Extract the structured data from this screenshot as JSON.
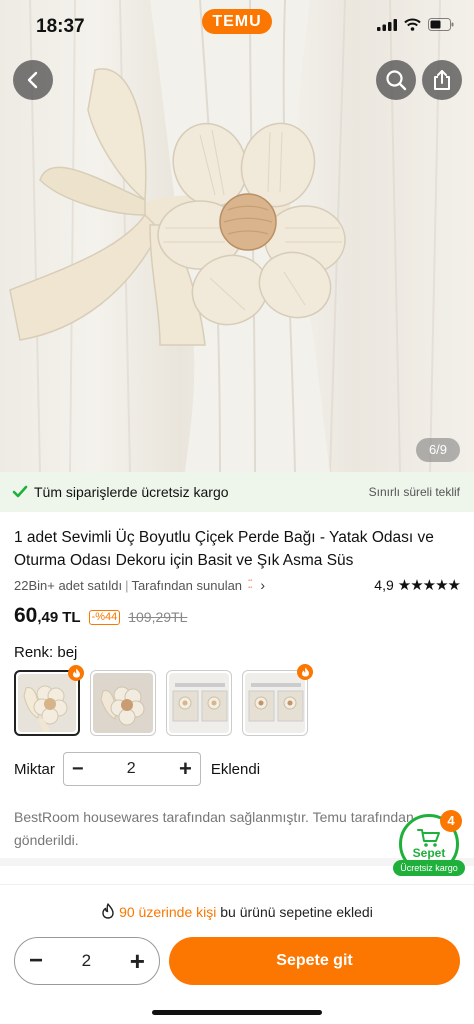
{
  "status_bar": {
    "time": "18:37"
  },
  "app": {
    "logo": "TEMU",
    "brand_color": "#fb7701",
    "success_color": "#1fb03c"
  },
  "gallery": {
    "counter": "6/9",
    "icons": [
      "back-icon",
      "search-icon",
      "share-icon"
    ]
  },
  "shipping_banner": {
    "text": "Tüm siparişlerde ücretsiz kargo",
    "right": "Sınırlı süreli teklif",
    "icon": "check-icon"
  },
  "product": {
    "title": "1 adet Sevimli Üç Boyutlu Çiçek Perde Bağı - Yatak Odası ve Oturma Odası Dekoru için Basit ve Şık Asma Süs",
    "sold": "22Bin+ adet satıldı",
    "separator": "|",
    "offered_by": "Tarafından sunulan",
    "rating": "4,9",
    "stars": "★★★★★",
    "price_int": "60",
    "price_dec": ",49",
    "currency": "TL",
    "discount": "-%44",
    "old_price": "109,29TL"
  },
  "variant": {
    "label": "Renk: bej"
  },
  "quantity": {
    "label": "Miktar",
    "minus": "−",
    "value": "2",
    "plus": "+",
    "status": "Eklendi"
  },
  "seller_note": "BestRoom housewares tarafından sağlanmıştır. Temu tarafından gönderildi.",
  "cart_float": {
    "count": "4",
    "label": "Sepet",
    "shipping": "Ücretsiz kargo"
  },
  "bottom_bar": {
    "social_count": "90 üzerinde kişi",
    "social_text": "bu ürünü sepetine ekledi",
    "minus": "−",
    "qty": "2",
    "plus": "+",
    "cta": "Sepete git"
  }
}
